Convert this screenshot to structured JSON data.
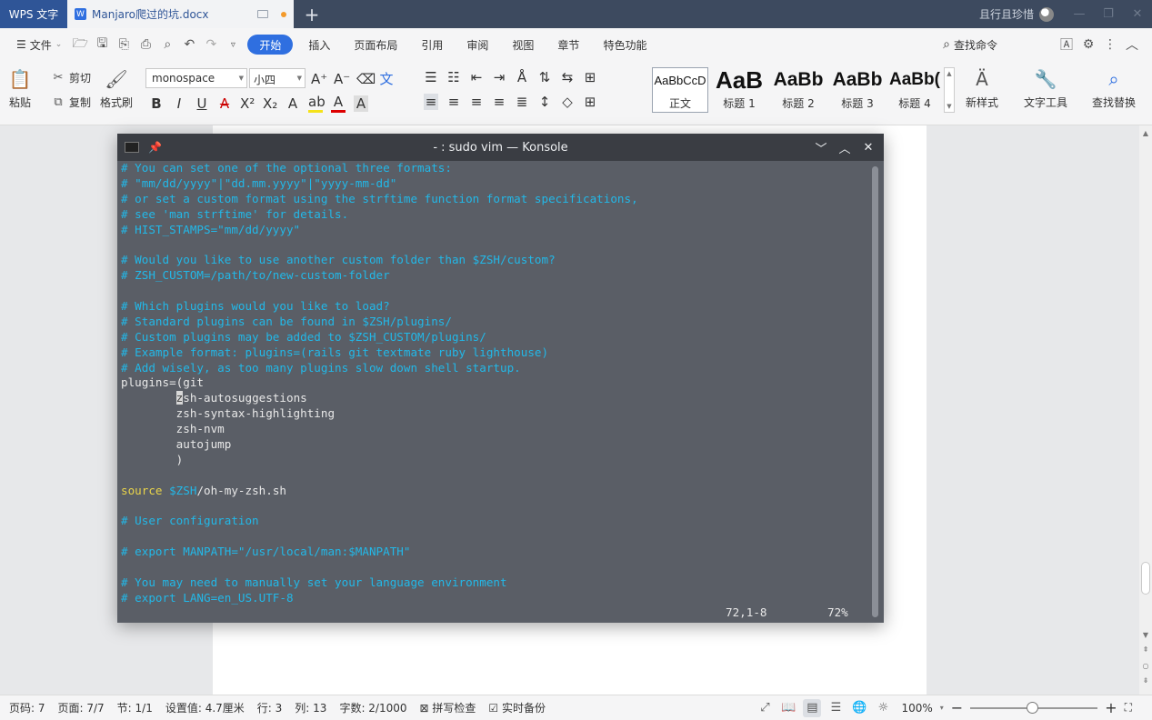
{
  "tabbar": {
    "app_label": "WPS 文字",
    "doc_tab_title": "Manjaro爬过的坑.docx",
    "doc_icon_letter": "W",
    "user_name": "且行且珍惜",
    "add_tab_symbol": "+"
  },
  "menubar": {
    "file_label": "文件",
    "tabs": [
      "开始",
      "插入",
      "页面布局",
      "引用",
      "审阅",
      "视图",
      "章节",
      "特色功能"
    ],
    "active_tab": "开始",
    "search_label": "查找命令"
  },
  "ribbon": {
    "paste_label": "粘贴",
    "cut_label": "剪切",
    "copy_label": "复制",
    "format_painter_label": "格式刷",
    "font_name": "monospace",
    "font_size": "小四",
    "styles": [
      {
        "sample": "AaBbCcD",
        "label": "正文"
      },
      {
        "sample": "AaB",
        "label": "标题 1"
      },
      {
        "sample": "AaBb",
        "label": "标题 2"
      },
      {
        "sample": "AaBb",
        "label": "标题 3"
      },
      {
        "sample": "AaBb(",
        "label": "标题 4"
      }
    ],
    "new_style_label": "新样式",
    "text_tools_label": "文字工具",
    "find_replace_label": "查找替换"
  },
  "konsole": {
    "title": "- : sudo vim — Konsole",
    "lines": [
      [
        {
          "t": "# You can set one of the optional three formats:",
          "c": "comment"
        }
      ],
      [
        {
          "t": "# \"mm/dd/yyyy\"|\"dd.mm.yyyy\"|\"yyyy-mm-dd\"",
          "c": "comment"
        }
      ],
      [
        {
          "t": "# or set a custom format using the strftime function format specifications,",
          "c": "comment"
        }
      ],
      [
        {
          "t": "# see 'man strftime' for details.",
          "c": "comment"
        }
      ],
      [
        {
          "t": "# HIST_STAMPS=\"mm/dd/yyyy\"",
          "c": "comment"
        }
      ],
      [
        {
          "t": "",
          "c": "white"
        }
      ],
      [
        {
          "t": "# Would you like to use another custom folder than $ZSH/custom?",
          "c": "comment"
        }
      ],
      [
        {
          "t": "# ZSH_CUSTOM=/path/to/new-custom-folder",
          "c": "comment"
        }
      ],
      [
        {
          "t": "",
          "c": "white"
        }
      ],
      [
        {
          "t": "# Which plugins would you like to load?",
          "c": "comment"
        }
      ],
      [
        {
          "t": "# Standard plugins can be found in $ZSH/plugins/",
          "c": "comment"
        }
      ],
      [
        {
          "t": "# Custom plugins may be added to $ZSH_CUSTOM/plugins/",
          "c": "comment"
        }
      ],
      [
        {
          "t": "# Example format: plugins=(rails git textmate ruby lighthouse)",
          "c": "comment"
        }
      ],
      [
        {
          "t": "# Add wisely, as too many plugins slow down shell startup.",
          "c": "comment"
        }
      ],
      [
        {
          "t": "plugins=(git",
          "c": "white"
        }
      ],
      [
        {
          "t": "        ",
          "c": "white"
        },
        {
          "t": "z",
          "c": "cursor"
        },
        {
          "t": "sh-autosuggestions",
          "c": "white"
        }
      ],
      [
        {
          "t": "        zsh-syntax-highlighting",
          "c": "white"
        }
      ],
      [
        {
          "t": "        zsh-nvm",
          "c": "white"
        }
      ],
      [
        {
          "t": "        autojump",
          "c": "white"
        }
      ],
      [
        {
          "t": "        )",
          "c": "white"
        }
      ],
      [
        {
          "t": "",
          "c": "white"
        }
      ],
      [
        {
          "t": "source",
          "c": "yellow"
        },
        {
          "t": " ",
          "c": "white"
        },
        {
          "t": "$ZSH",
          "c": "var"
        },
        {
          "t": "/oh-my-zsh.sh",
          "c": "white"
        }
      ],
      [
        {
          "t": "",
          "c": "white"
        }
      ],
      [
        {
          "t": "# User configuration",
          "c": "comment"
        }
      ],
      [
        {
          "t": "",
          "c": "white"
        }
      ],
      [
        {
          "t": "# export MANPATH=\"/usr/local/man:$MANPATH\"",
          "c": "comment"
        }
      ],
      [
        {
          "t": "",
          "c": "white"
        }
      ],
      [
        {
          "t": "# You may need to manually set your language environment",
          "c": "comment"
        }
      ],
      [
        {
          "t": "# export LANG=en_US.UTF-8",
          "c": "comment"
        }
      ]
    ],
    "cursor_position": "72,1-8",
    "scroll_percent": "72%"
  },
  "statusbar": {
    "page_num": "页码: 7",
    "pages": "页面: 7/7",
    "section": "节: 1/1",
    "setting": "设置值: 4.7厘米",
    "row": "行: 3",
    "col": "列: 13",
    "words": "字数: 2/1000",
    "spell_check": "拼写检查",
    "backup": "实时备份",
    "zoom": "100%"
  },
  "colors": {
    "accent": "#2f6fe0",
    "comment": "#22b8e8",
    "keyword": "#e9d44a",
    "terminal_bg": "#5a5e66"
  }
}
